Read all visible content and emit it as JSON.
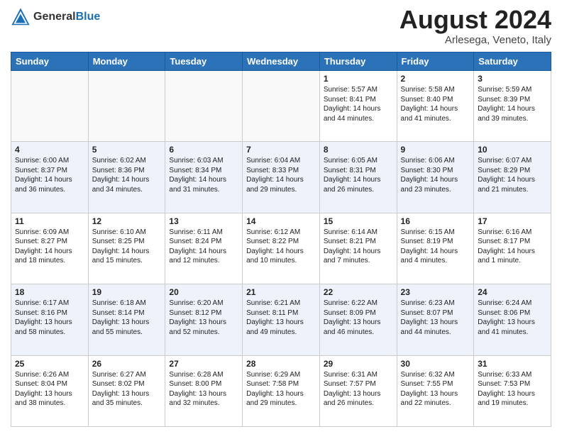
{
  "header": {
    "logo_line1": "General",
    "logo_line2": "Blue",
    "month_year": "August 2024",
    "location": "Arlesega, Veneto, Italy"
  },
  "days_of_week": [
    "Sunday",
    "Monday",
    "Tuesday",
    "Wednesday",
    "Thursday",
    "Friday",
    "Saturday"
  ],
  "weeks": [
    [
      {
        "day": "",
        "content": ""
      },
      {
        "day": "",
        "content": ""
      },
      {
        "day": "",
        "content": ""
      },
      {
        "day": "",
        "content": ""
      },
      {
        "day": "1",
        "content": "Sunrise: 5:57 AM\nSunset: 8:41 PM\nDaylight: 14 hours\nand 44 minutes."
      },
      {
        "day": "2",
        "content": "Sunrise: 5:58 AM\nSunset: 8:40 PM\nDaylight: 14 hours\nand 41 minutes."
      },
      {
        "day": "3",
        "content": "Sunrise: 5:59 AM\nSunset: 8:39 PM\nDaylight: 14 hours\nand 39 minutes."
      }
    ],
    [
      {
        "day": "4",
        "content": "Sunrise: 6:00 AM\nSunset: 8:37 PM\nDaylight: 14 hours\nand 36 minutes."
      },
      {
        "day": "5",
        "content": "Sunrise: 6:02 AM\nSunset: 8:36 PM\nDaylight: 14 hours\nand 34 minutes."
      },
      {
        "day": "6",
        "content": "Sunrise: 6:03 AM\nSunset: 8:34 PM\nDaylight: 14 hours\nand 31 minutes."
      },
      {
        "day": "7",
        "content": "Sunrise: 6:04 AM\nSunset: 8:33 PM\nDaylight: 14 hours\nand 29 minutes."
      },
      {
        "day": "8",
        "content": "Sunrise: 6:05 AM\nSunset: 8:31 PM\nDaylight: 14 hours\nand 26 minutes."
      },
      {
        "day": "9",
        "content": "Sunrise: 6:06 AM\nSunset: 8:30 PM\nDaylight: 14 hours\nand 23 minutes."
      },
      {
        "day": "10",
        "content": "Sunrise: 6:07 AM\nSunset: 8:29 PM\nDaylight: 14 hours\nand 21 minutes."
      }
    ],
    [
      {
        "day": "11",
        "content": "Sunrise: 6:09 AM\nSunset: 8:27 PM\nDaylight: 14 hours\nand 18 minutes."
      },
      {
        "day": "12",
        "content": "Sunrise: 6:10 AM\nSunset: 8:25 PM\nDaylight: 14 hours\nand 15 minutes."
      },
      {
        "day": "13",
        "content": "Sunrise: 6:11 AM\nSunset: 8:24 PM\nDaylight: 14 hours\nand 12 minutes."
      },
      {
        "day": "14",
        "content": "Sunrise: 6:12 AM\nSunset: 8:22 PM\nDaylight: 14 hours\nand 10 minutes."
      },
      {
        "day": "15",
        "content": "Sunrise: 6:14 AM\nSunset: 8:21 PM\nDaylight: 14 hours\nand 7 minutes."
      },
      {
        "day": "16",
        "content": "Sunrise: 6:15 AM\nSunset: 8:19 PM\nDaylight: 14 hours\nand 4 minutes."
      },
      {
        "day": "17",
        "content": "Sunrise: 6:16 AM\nSunset: 8:17 PM\nDaylight: 14 hours\nand 1 minute."
      }
    ],
    [
      {
        "day": "18",
        "content": "Sunrise: 6:17 AM\nSunset: 8:16 PM\nDaylight: 13 hours\nand 58 minutes."
      },
      {
        "day": "19",
        "content": "Sunrise: 6:18 AM\nSunset: 8:14 PM\nDaylight: 13 hours\nand 55 minutes."
      },
      {
        "day": "20",
        "content": "Sunrise: 6:20 AM\nSunset: 8:12 PM\nDaylight: 13 hours\nand 52 minutes."
      },
      {
        "day": "21",
        "content": "Sunrise: 6:21 AM\nSunset: 8:11 PM\nDaylight: 13 hours\nand 49 minutes."
      },
      {
        "day": "22",
        "content": "Sunrise: 6:22 AM\nSunset: 8:09 PM\nDaylight: 13 hours\nand 46 minutes."
      },
      {
        "day": "23",
        "content": "Sunrise: 6:23 AM\nSunset: 8:07 PM\nDaylight: 13 hours\nand 44 minutes."
      },
      {
        "day": "24",
        "content": "Sunrise: 6:24 AM\nSunset: 8:06 PM\nDaylight: 13 hours\nand 41 minutes."
      }
    ],
    [
      {
        "day": "25",
        "content": "Sunrise: 6:26 AM\nSunset: 8:04 PM\nDaylight: 13 hours\nand 38 minutes."
      },
      {
        "day": "26",
        "content": "Sunrise: 6:27 AM\nSunset: 8:02 PM\nDaylight: 13 hours\nand 35 minutes."
      },
      {
        "day": "27",
        "content": "Sunrise: 6:28 AM\nSunset: 8:00 PM\nDaylight: 13 hours\nand 32 minutes."
      },
      {
        "day": "28",
        "content": "Sunrise: 6:29 AM\nSunset: 7:58 PM\nDaylight: 13 hours\nand 29 minutes."
      },
      {
        "day": "29",
        "content": "Sunrise: 6:31 AM\nSunset: 7:57 PM\nDaylight: 13 hours\nand 26 minutes."
      },
      {
        "day": "30",
        "content": "Sunrise: 6:32 AM\nSunset: 7:55 PM\nDaylight: 13 hours\nand 22 minutes."
      },
      {
        "day": "31",
        "content": "Sunrise: 6:33 AM\nSunset: 7:53 PM\nDaylight: 13 hours\nand 19 minutes."
      }
    ]
  ]
}
